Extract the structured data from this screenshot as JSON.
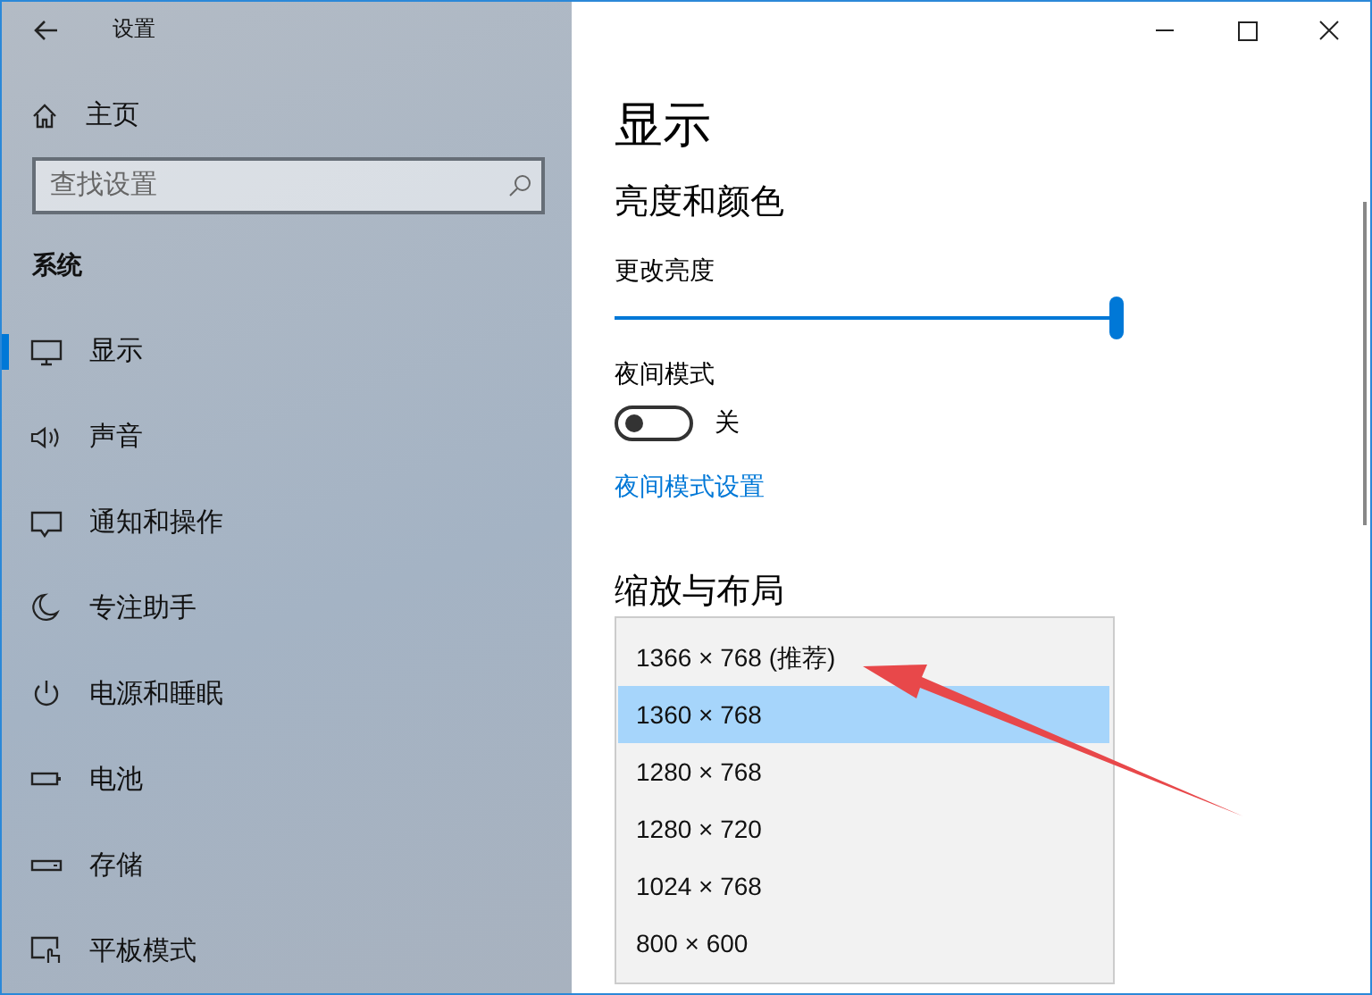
{
  "window": {
    "title": "设置"
  },
  "sidebar": {
    "home": "主页",
    "search": {
      "placeholder": "查找设置"
    },
    "section": "系统",
    "items": [
      {
        "label": "显示",
        "selected": true
      },
      {
        "label": "声音",
        "selected": false
      },
      {
        "label": "通知和操作",
        "selected": false
      },
      {
        "label": "专注助手",
        "selected": false
      },
      {
        "label": "电源和睡眠",
        "selected": false
      },
      {
        "label": "电池",
        "selected": false
      },
      {
        "label": "存储",
        "selected": false
      },
      {
        "label": "平板模式",
        "selected": false
      }
    ]
  },
  "content": {
    "title": "显示",
    "heading": "亮度和颜色",
    "brightness": {
      "label": "更改亮度",
      "level": 1
    },
    "night_mode": {
      "label": "夜间模式",
      "on": false,
      "state": "关"
    },
    "night_link": "夜间模式设置",
    "scale_heading": "缩放与布局",
    "resolution_options": [
      {
        "label": "1366 × 768 (推荐)",
        "selected": false
      },
      {
        "label": "1360 × 768",
        "selected": true
      },
      {
        "label": "1280 × 768",
        "selected": false
      },
      {
        "label": "1280 × 720",
        "selected": false
      },
      {
        "label": "1024 × 768",
        "selected": false
      },
      {
        "label": "800 × 600",
        "selected": false
      }
    ]
  }
}
